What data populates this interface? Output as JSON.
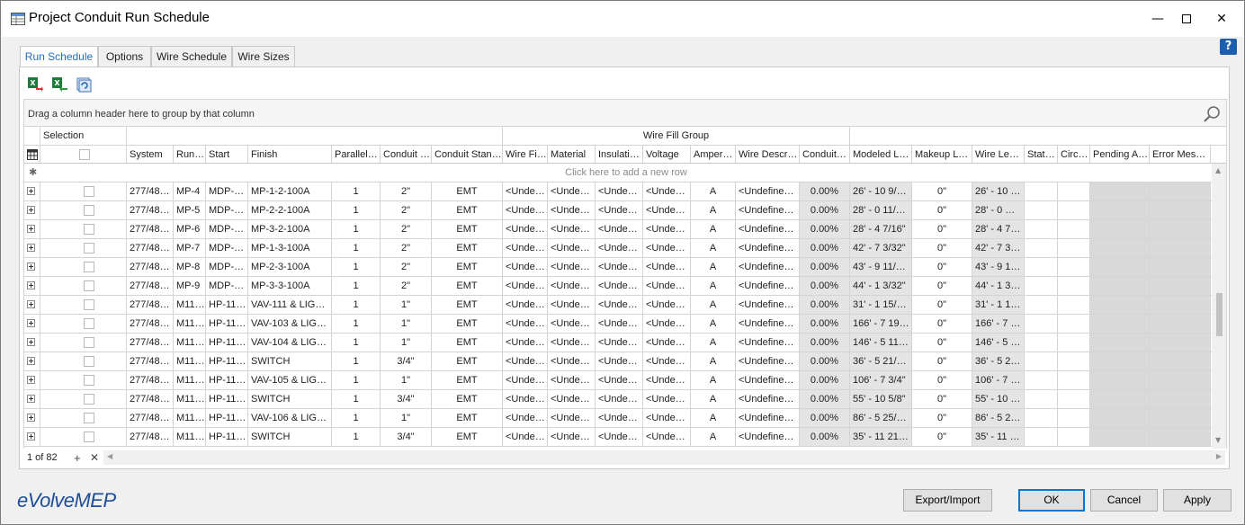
{
  "window": {
    "title": "Project Conduit Run Schedule",
    "brand": "eVolveMEP"
  },
  "tabs": [
    "Run Schedule",
    "Options",
    "Wire Schedule",
    "Wire Sizes"
  ],
  "toolbar": {
    "icons": [
      "export-excel-icon",
      "import-excel-icon",
      "refresh-icon"
    ]
  },
  "grid": {
    "group_bar_text": "Drag a column header here to group by that column",
    "group_headers": {
      "selection": "Selection",
      "wire_fill_group": "Wire Fill Group"
    },
    "columns": [
      "System",
      "Run…",
      "Start",
      "Finish",
      "Parallel …",
      "Conduit …",
      "Conduit Stan…",
      "Wire Fi…",
      "Material",
      "Insulati…",
      "Voltage",
      "Amper…",
      "Wire Descri…",
      "Conduit…",
      "Modeled L…",
      "Makeup L…",
      "Wire Le…",
      "Stat…",
      "Circ…",
      "Pending A…",
      "Error Mes…"
    ],
    "new_row_text": "Click here to add a new row",
    "rows": [
      [
        "277/48…",
        "MP-4",
        "MDP-…",
        "MP-1-2-100A",
        "1",
        "2\"",
        "EMT",
        "<Unde…",
        "<Unde…",
        "<Unde…",
        "<Unde…",
        "A",
        "<Undefine…",
        "0.00%",
        "26' - 10 9/…",
        "0\"",
        "26' - 10 …"
      ],
      [
        "277/48…",
        "MP-5",
        "MDP-…",
        "MP-2-2-100A",
        "1",
        "2\"",
        "EMT",
        "<Unde…",
        "<Unde…",
        "<Unde…",
        "<Unde…",
        "A",
        "<Undefine…",
        "0.00%",
        "28' - 0 11/…",
        "0\"",
        "28' - 0 …"
      ],
      [
        "277/48…",
        "MP-6",
        "MDP-…",
        "MP-3-2-100A",
        "1",
        "2\"",
        "EMT",
        "<Unde…",
        "<Unde…",
        "<Unde…",
        "<Unde…",
        "A",
        "<Undefine…",
        "0.00%",
        "28' - 4 7/16\"",
        "0\"",
        "28' - 4 7…"
      ],
      [
        "277/48…",
        "MP-7",
        "MDP-…",
        "MP-1-3-100A",
        "1",
        "2\"",
        "EMT",
        "<Unde…",
        "<Unde…",
        "<Unde…",
        "<Unde…",
        "A",
        "<Undefine…",
        "0.00%",
        "42' - 7 3/32\"",
        "0\"",
        "42' - 7 3…"
      ],
      [
        "277/48…",
        "MP-8",
        "MDP-…",
        "MP-2-3-100A",
        "1",
        "2\"",
        "EMT",
        "<Unde…",
        "<Unde…",
        "<Unde…",
        "<Unde…",
        "A",
        "<Undefine…",
        "0.00%",
        "43' - 9 11/…",
        "0\"",
        "43' - 9 1…"
      ],
      [
        "277/48…",
        "MP-9",
        "MDP-…",
        "MP-3-3-100A",
        "1",
        "2\"",
        "EMT",
        "<Unde…",
        "<Unde…",
        "<Unde…",
        "<Unde…",
        "A",
        "<Undefine…",
        "0.00%",
        "44' - 1 3/32\"",
        "0\"",
        "44' - 1 3…"
      ],
      [
        "277/48…",
        "M11…",
        "HP-11…",
        "VAV-111 & LIG…",
        "1",
        "1\"",
        "EMT",
        "<Unde…",
        "<Unde…",
        "<Unde…",
        "<Unde…",
        "A",
        "<Undefine…",
        "0.00%",
        "31' - 1 15/…",
        "0\"",
        "31' - 1 1…"
      ],
      [
        "277/48…",
        "M11…",
        "HP-11…",
        "VAV-103 & LIG…",
        "1",
        "1\"",
        "EMT",
        "<Unde…",
        "<Unde…",
        "<Unde…",
        "<Unde…",
        "A",
        "<Undefine…",
        "0.00%",
        "166' - 7 19…",
        "0\"",
        "166' - 7 …"
      ],
      [
        "277/48…",
        "M11…",
        "HP-11…",
        "VAV-104 & LIG…",
        "1",
        "1\"",
        "EMT",
        "<Unde…",
        "<Unde…",
        "<Unde…",
        "<Unde…",
        "A",
        "<Undefine…",
        "0.00%",
        "146' - 5 11…",
        "0\"",
        "146' - 5 …"
      ],
      [
        "277/48…",
        "M11…",
        "HP-11…",
        "SWITCH",
        "1",
        "3/4\"",
        "EMT",
        "<Unde…",
        "<Unde…",
        "<Unde…",
        "<Unde…",
        "A",
        "<Undefine…",
        "0.00%",
        "36' - 5 21/…",
        "0\"",
        "36' - 5 2…"
      ],
      [
        "277/48…",
        "M11…",
        "HP-11…",
        "VAV-105 & LIG…",
        "1",
        "1\"",
        "EMT",
        "<Unde…",
        "<Unde…",
        "<Unde…",
        "<Unde…",
        "A",
        "<Undefine…",
        "0.00%",
        "106' - 7 3/4\"",
        "0\"",
        "106' - 7 …"
      ],
      [
        "277/48…",
        "M11…",
        "HP-11…",
        "SWITCH",
        "1",
        "3/4\"",
        "EMT",
        "<Unde…",
        "<Unde…",
        "<Unde…",
        "<Unde…",
        "A",
        "<Undefine…",
        "0.00%",
        "55' - 10 5/8\"",
        "0\"",
        "55' - 10 …"
      ],
      [
        "277/48…",
        "M11…",
        "HP-11…",
        "VAV-106 & LIG…",
        "1",
        "1\"",
        "EMT",
        "<Unde…",
        "<Unde…",
        "<Unde…",
        "<Unde…",
        "A",
        "<Undefine…",
        "0.00%",
        "86' - 5 25/…",
        "0\"",
        "86' - 5 2…"
      ],
      [
        "277/48…",
        "M11…",
        "HP-11…",
        "SWITCH",
        "1",
        "3/4\"",
        "EMT",
        "<Unde…",
        "<Unde…",
        "<Unde…",
        "<Unde…",
        "A",
        "<Undefine…",
        "0.00%",
        "35' - 11 21…",
        "0\"",
        "35' - 11 …"
      ]
    ],
    "pager": "1 of 82"
  },
  "buttons": {
    "export_import": "Export/Import",
    "ok": "OK",
    "cancel": "Cancel",
    "apply": "Apply"
  },
  "colors": {
    "accent": "#1e6fbf",
    "brand": "#1f4e99",
    "help": "#1c5fae"
  }
}
